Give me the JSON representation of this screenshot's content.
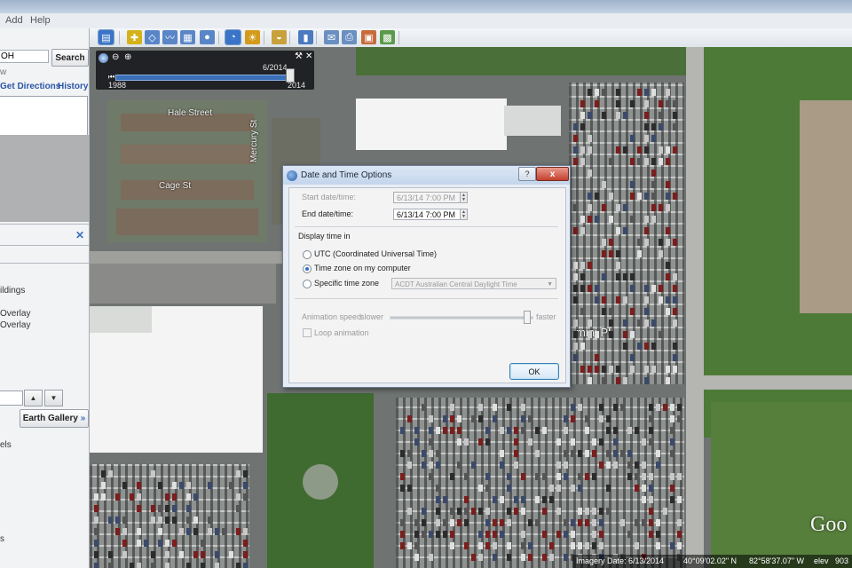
{
  "menu": {
    "add": "Add",
    "help": "Help"
  },
  "toolbar": {
    "buttons": [
      {
        "name": "hide-sidebar-icon",
        "color": "#3a74c8",
        "glyph": "▤"
      },
      {
        "name": "placemark-icon",
        "color": "#d4b21a",
        "glyph": "✚"
      },
      {
        "name": "polygon-icon",
        "color": "#5a86c8",
        "glyph": "◇"
      },
      {
        "name": "path-icon",
        "color": "#5a86c8",
        "glyph": "〰"
      },
      {
        "name": "image-overlay-icon",
        "color": "#5a86c8",
        "glyph": "▦"
      },
      {
        "name": "record-tour-icon",
        "color": "#5a86c8",
        "glyph": "●"
      },
      {
        "name": "historical-imagery-icon",
        "color": "#3a74c8",
        "glyph": "◔"
      },
      {
        "name": "sunlight-icon",
        "color": "#d49a1a",
        "glyph": "☀"
      },
      {
        "name": "planets-icon",
        "color": "#c8a13a",
        "glyph": "◒"
      },
      {
        "name": "ruler-icon",
        "color": "#4a7ac0",
        "glyph": "▮"
      },
      {
        "name": "email-icon",
        "color": "#6a8fc0",
        "glyph": "✉"
      },
      {
        "name": "print-icon",
        "color": "#6a8fc0",
        "glyph": "⎙"
      },
      {
        "name": "save-image-icon",
        "color": "#c86a3a",
        "glyph": "▣"
      },
      {
        "name": "view-in-maps-icon",
        "color": "#5a9a4a",
        "glyph": "▩"
      }
    ]
  },
  "sidebar": {
    "search_value": "OH",
    "search_label": "Search",
    "partial_w": "w",
    "get_directions": "Get Directions",
    "history": "History",
    "layers_fragments": [
      "ildings",
      "Overlay",
      "Overlay"
    ],
    "earth_gallery": "Earth Gallery",
    "bottom_fragments": [
      "els",
      "s"
    ]
  },
  "timeline": {
    "start_year": "1988",
    "end_year": "2014",
    "current": "6/2014"
  },
  "dialog": {
    "title": "Date and Time Options",
    "help": "?",
    "close": "x",
    "start_label": "Start date/time:",
    "start_value": "6/13/14 7:00 PM",
    "end_label": "End date/time:",
    "end_value": "6/13/14 7:00 PM",
    "section_label": "Display time in",
    "options": [
      {
        "label": "UTC (Coordinated Universal Time)",
        "selected": false
      },
      {
        "label": "Time zone on my computer",
        "selected": true
      },
      {
        "label": "Specific time zone",
        "selected": false
      }
    ],
    "timezone_value": "ACDT Australian Central Daylight Time",
    "anim_label": "Animation speed:",
    "slower": "slower",
    "faster": "faster",
    "loop_label": "Loop animation",
    "ok": "OK"
  },
  "map_labels": {
    "hale_street": "Hale Street",
    "cage_st": "Cage St",
    "mercury_st": "Mercury St",
    "mini_pl": "mini Pl"
  },
  "status": {
    "imagery_date": "Imagery Date: 6/13/2014",
    "lat": "40°09'02.02\" N",
    "lon": "82°58'37.07\" W",
    "elev": "elev",
    "elev_value": "903"
  },
  "brand": "Goo"
}
